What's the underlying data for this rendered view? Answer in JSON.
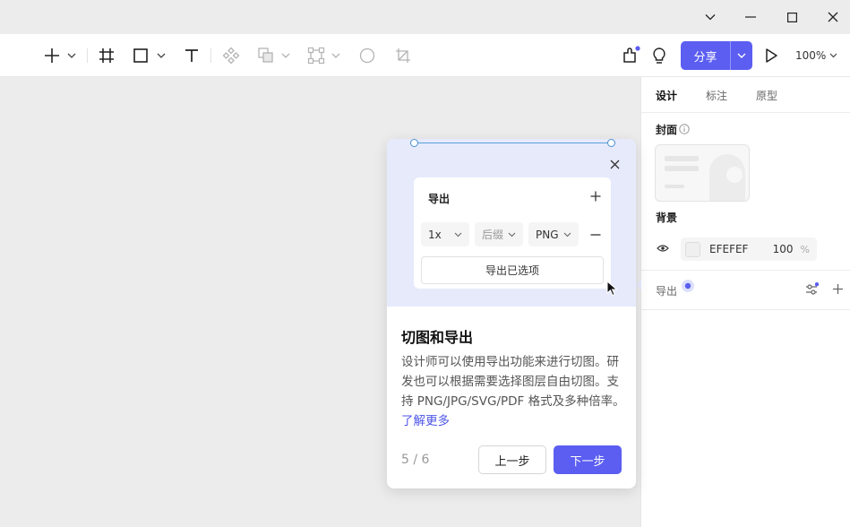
{
  "toolbar": {
    "share_label": "分享",
    "zoom_label": "100%",
    "accent_color": "#5b5ef0"
  },
  "panel": {
    "tabs": [
      {
        "label": "设计",
        "active": true
      },
      {
        "label": "标注",
        "active": false
      },
      {
        "label": "原型",
        "active": false
      }
    ],
    "cover_label": "封面",
    "background_label": "背景",
    "bg_color_hex": "EFEFEF",
    "bg_opacity": "100",
    "bg_opacity_unit": "%",
    "export_label": "导出"
  },
  "tour": {
    "preview": {
      "title": "导出",
      "scale": "1x",
      "suffix_placeholder": "后缀",
      "format": "PNG",
      "export_selected": "导出已选项"
    },
    "title": "切图和导出",
    "body": "设计师可以使用导出功能来进行切图。研发也可以根据需要选择图层自由切图。支持 PNG/JPG/SVG/PDF 格式及多种倍率。",
    "learn_more": "了解更多",
    "step": "5 / 6",
    "prev_label": "上一步",
    "next_label": "下一步"
  }
}
